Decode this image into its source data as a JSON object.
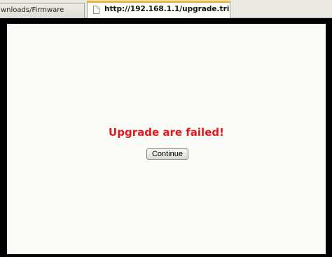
{
  "tabs": [
    {
      "label": "wnloads/Firmware",
      "active": false
    },
    {
      "label": "http://192.168.1.1/upgrade.tri",
      "active": true,
      "icon": "page-icon"
    }
  ],
  "page": {
    "message": "Upgrade are failed!",
    "continue_label": "Continue"
  },
  "colors": {
    "message": "#e8161a",
    "frame": "#000000",
    "active_tab_accent": "#f2b33d",
    "viewport_bg": "#fbfcf7"
  }
}
